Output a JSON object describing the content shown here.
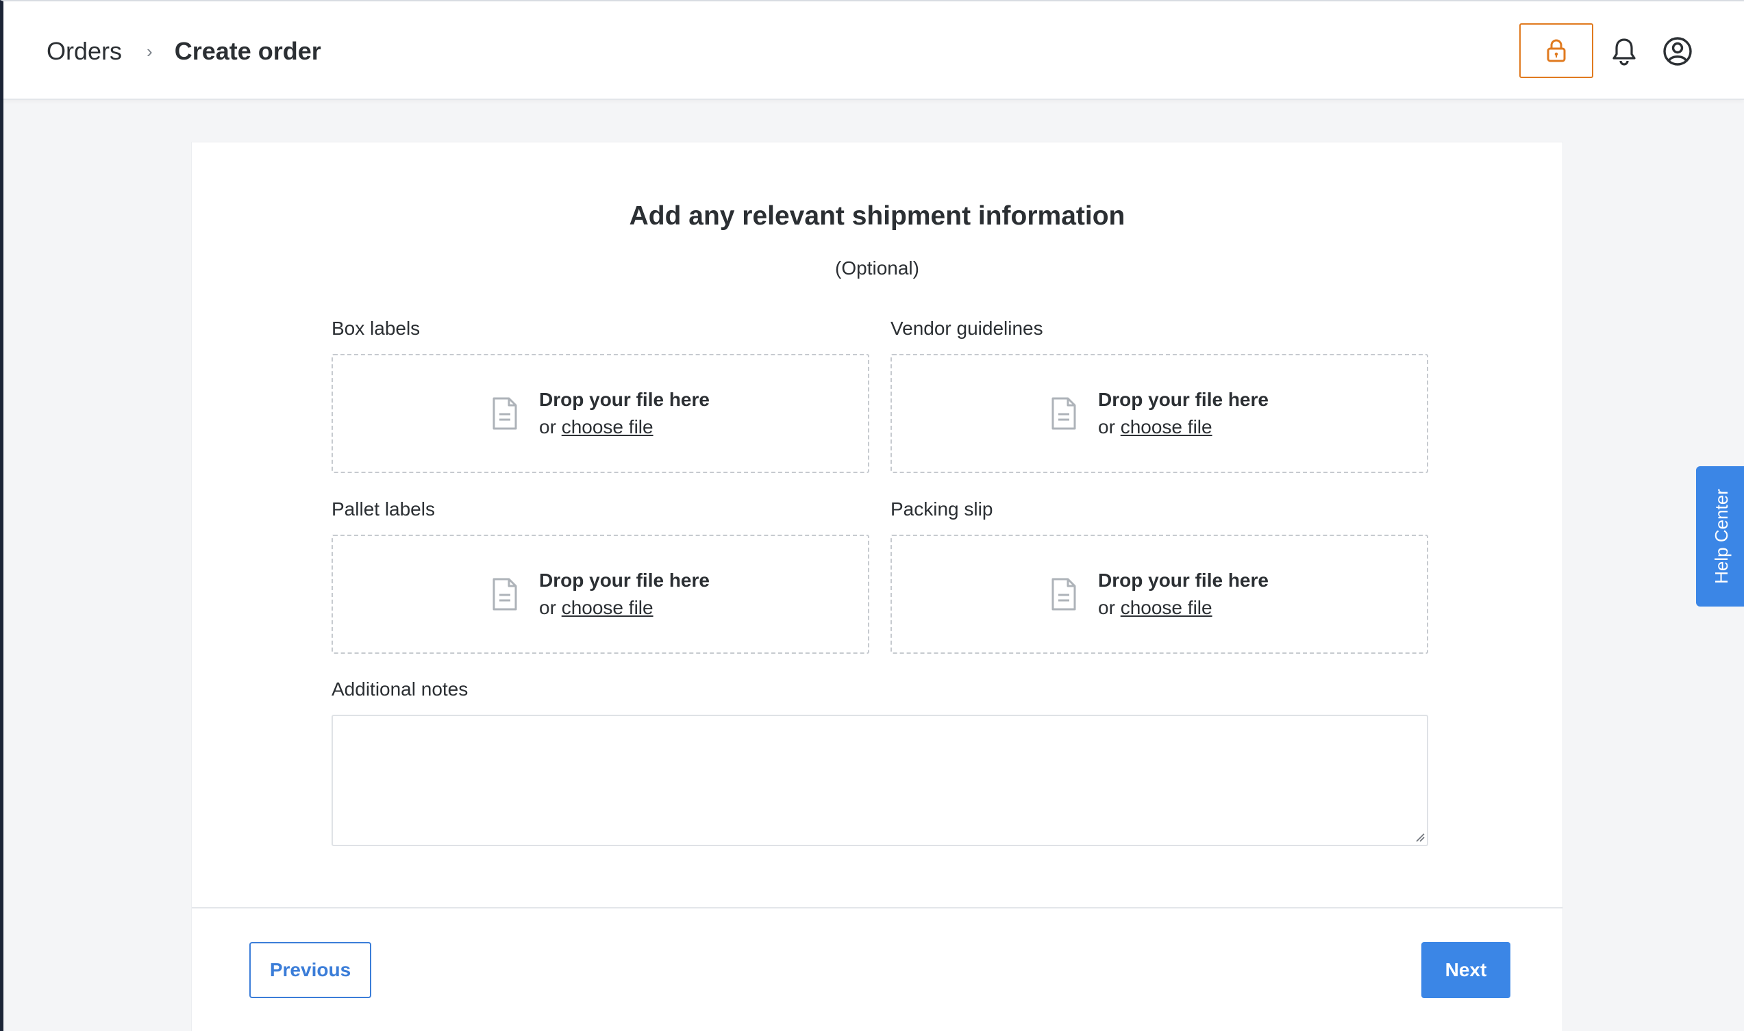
{
  "header": {
    "breadcrumb_root": "Orders",
    "breadcrumb_separator": "›",
    "breadcrumb_current": "Create order",
    "lock_icon": "lock-icon",
    "bell_icon": "bell-icon",
    "user_icon": "user-circle-icon",
    "accent_color": "#e07a1f"
  },
  "card": {
    "title": "Add any relevant shipment information",
    "subtitle": "(Optional)",
    "uploads": [
      {
        "label": "Box labels",
        "drop_text": "Drop your file here",
        "or_text": "or",
        "link_text": "choose file"
      },
      {
        "label": "Vendor guidelines",
        "drop_text": "Drop your file here",
        "or_text": "or",
        "link_text": "choose file"
      },
      {
        "label": "Pallet labels",
        "drop_text": "Drop your file here",
        "or_text": "or",
        "link_text": "choose file"
      },
      {
        "label": "Packing slip",
        "drop_text": "Drop your file here",
        "or_text": "or",
        "link_text": "choose file"
      }
    ],
    "notes_label": "Additional notes",
    "notes_value": ""
  },
  "footer": {
    "previous_label": "Previous",
    "next_label": "Next",
    "primary_color": "#3b86e6"
  },
  "help_tab": {
    "label": "Help Center"
  }
}
